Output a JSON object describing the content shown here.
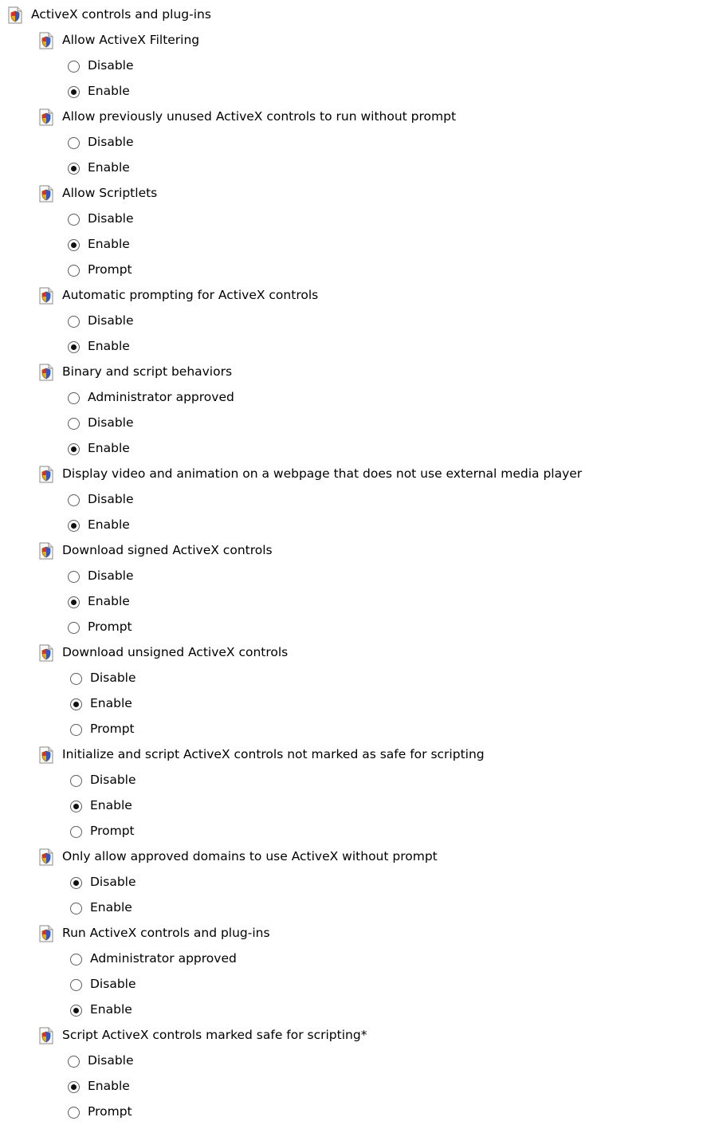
{
  "root": {
    "label": "ActiveX controls and plug-ins",
    "icon": "settings-shield-icon"
  },
  "settings": [
    {
      "label": "Allow ActiveX Filtering",
      "options": [
        {
          "label": "Disable",
          "checked": false
        },
        {
          "label": "Enable",
          "checked": true
        }
      ]
    },
    {
      "label": "Allow previously unused ActiveX controls to run without prompt",
      "options": [
        {
          "label": "Disable",
          "checked": false
        },
        {
          "label": "Enable",
          "checked": true
        }
      ]
    },
    {
      "label": "Allow Scriptlets",
      "options": [
        {
          "label": "Disable",
          "checked": false
        },
        {
          "label": "Enable",
          "checked": true
        },
        {
          "label": "Prompt",
          "checked": false
        }
      ]
    },
    {
      "label": "Automatic prompting for ActiveX controls",
      "options": [
        {
          "label": "Disable",
          "checked": false
        },
        {
          "label": "Enable",
          "checked": true
        }
      ]
    },
    {
      "label": "Binary and script behaviors",
      "options": [
        {
          "label": "Administrator approved",
          "checked": false
        },
        {
          "label": "Disable",
          "checked": false
        },
        {
          "label": "Enable",
          "checked": true
        }
      ]
    },
    {
      "label": "Display video and animation on a webpage that does not use external media player",
      "options": [
        {
          "label": "Disable",
          "checked": false
        },
        {
          "label": "Enable",
          "checked": true
        }
      ]
    },
    {
      "label": "Download signed ActiveX controls",
      "options": [
        {
          "label": "Disable",
          "checked": false
        },
        {
          "label": "Enable",
          "checked": true
        },
        {
          "label": "Prompt",
          "checked": false
        }
      ]
    },
    {
      "label": "Download unsigned ActiveX controls",
      "options": [
        {
          "label": "Disable",
          "checked": false
        },
        {
          "label": "Enable",
          "checked": true
        },
        {
          "label": "Prompt",
          "checked": false
        }
      ]
    },
    {
      "label": "Initialize and script ActiveX controls not marked as safe for scripting",
      "options": [
        {
          "label": "Disable",
          "checked": false
        },
        {
          "label": "Enable",
          "checked": true
        },
        {
          "label": "Prompt",
          "checked": false
        }
      ]
    },
    {
      "label": "Only allow approved domains to use ActiveX without prompt",
      "options": [
        {
          "label": "Disable",
          "checked": true
        },
        {
          "label": "Enable",
          "checked": false
        }
      ]
    },
    {
      "label": "Run ActiveX controls and plug-ins",
      "options": [
        {
          "label": "Administrator approved",
          "checked": false
        },
        {
          "label": "Disable",
          "checked": false
        },
        {
          "label": "Enable",
          "checked": true
        }
      ]
    },
    {
      "label": "Script ActiveX controls marked safe for scripting*",
      "options": [
        {
          "label": "Disable",
          "checked": false
        },
        {
          "label": "Enable",
          "checked": true
        },
        {
          "label": "Prompt",
          "checked": false
        }
      ]
    }
  ]
}
